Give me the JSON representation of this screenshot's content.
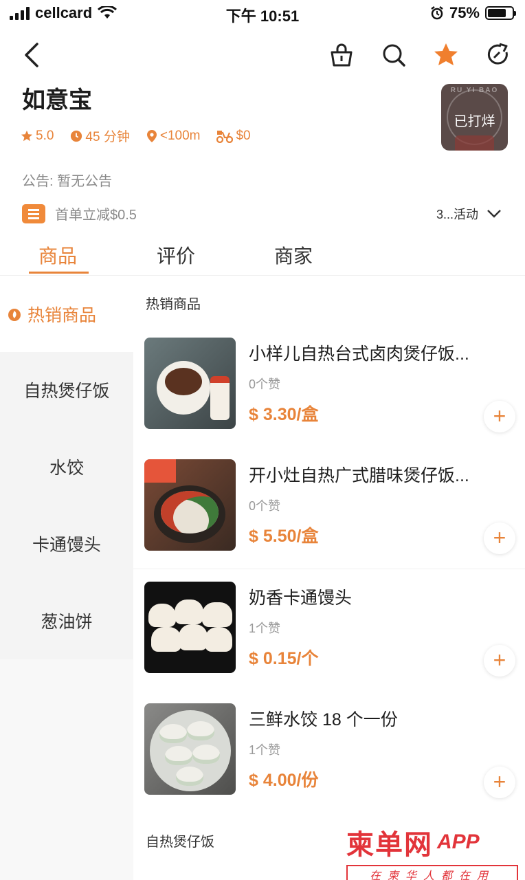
{
  "status_bar": {
    "carrier": "cellcard",
    "time": "下午 10:51",
    "battery_percent": "75%",
    "battery_level": 0.75
  },
  "nav": {
    "icons": [
      "back-icon",
      "bag-icon",
      "search-icon",
      "star-icon",
      "share-icon"
    ],
    "accent_color": "#e8843a"
  },
  "store": {
    "name": "如意宝",
    "logo_text": "RU YI BAO",
    "closed_label": "已打烊",
    "rating": "5.0",
    "delivery_time": "45 分钟",
    "distance": "<100m",
    "delivery_fee": "$0",
    "notice": "公告: 暂无公告",
    "promo_text": "首单立减$0.5",
    "activities_label": "3...活动"
  },
  "tabs": [
    {
      "label": "商品",
      "active": true
    },
    {
      "label": "评价",
      "active": false
    },
    {
      "label": "商家",
      "active": false
    }
  ],
  "sidebar": {
    "items": [
      {
        "label": "热销商品",
        "active": true
      },
      {
        "label": "自热煲仔饭",
        "active": false
      },
      {
        "label": "水饺",
        "active": false
      },
      {
        "label": "卡通馒头",
        "active": false
      },
      {
        "label": "葱油饼",
        "active": false
      }
    ]
  },
  "content": {
    "section_hot": "热销商品",
    "section_next": "自热煲仔饭",
    "products": [
      {
        "name": "小样儿自热台式卤肉煲仔饭...",
        "likes": "0个赞",
        "price": "$ 3.30/盒",
        "add": "+"
      },
      {
        "name": "开小灶自热广式腊味煲仔饭...",
        "likes": "0个赞",
        "price": "$ 5.50/盒",
        "add": "+"
      },
      {
        "name": "奶香卡通馒头",
        "likes": "1个赞",
        "price": "$ 0.15/个",
        "add": "+"
      },
      {
        "name": "三鲜水饺 18 个一份",
        "likes": "1个赞",
        "price": "$ 4.00/份",
        "add": "+"
      }
    ]
  },
  "watermark": {
    "brand": "柬单网",
    "app": "APP",
    "slogan": "在柬华人都在用"
  }
}
